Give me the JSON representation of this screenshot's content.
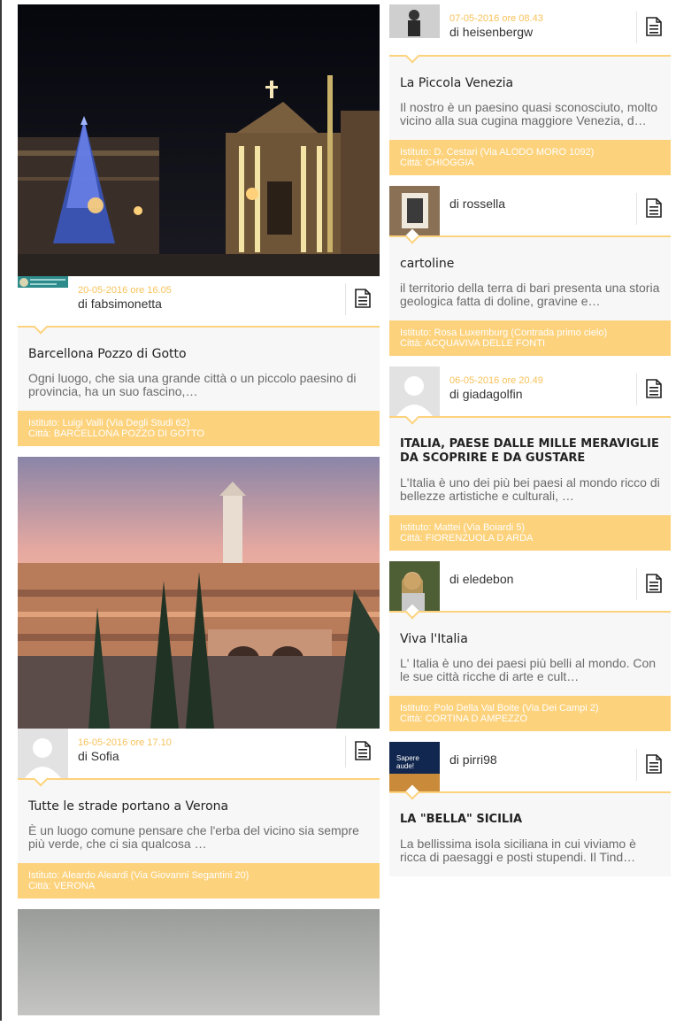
{
  "left": [
    {
      "date": "20-05-2016 ore 16.05",
      "author": "di fabsimonetta",
      "title": "Barcellona Pozzo di Gotto",
      "excerpt": "Ogni luogo, che sia una grande città o un piccolo paesino di provincia, ha un suo fascino,…",
      "istituto": "Istituto: Luigi Valli (Via Degli Studi 62)",
      "citta": "Città: BARCELLONA POZZO DI GOTTO"
    },
    {
      "date": "16-05-2016 ore 17.10",
      "author": "di Sofia",
      "title": "Tutte le strade portano a Verona",
      "excerpt": "È un luogo comune pensare che l'erba del vicino sia sempre più verde, che ci sia qualcosa …",
      "istituto": "Istituto: Aleardo Aleardi (Via Giovanni Segantini 20)",
      "citta": "Città: VERONA"
    }
  ],
  "right": [
    {
      "date": "07-05-2016 ore 08.43",
      "author": "di heisenbergw",
      "title": "La Piccola Venezia",
      "excerpt": "Il nostro è un paesino quasi sconosciuto, molto vicino alla sua cugina maggiore Venezia, d…",
      "istituto": "Istituto: D. Cestari (Via ALODO MORO 1092)",
      "citta": "Città: CHIOGGIA"
    },
    {
      "author": "di rossella",
      "title": "cartoline",
      "excerpt": "il territorio della terra di bari presenta una storia geologica fatta di doline, gravine e…",
      "istituto": "Istituto: Rosa Luxemburg (Contrada primo cielo)",
      "citta": "Città: ACQUAVIVA DELLE FONTI"
    },
    {
      "date": "06-05-2016 ore 20.49",
      "author": "di giadagolfin",
      "title": "ITALIA, PAESE DALLE MILLE MERAVIGLIE DA SCOPRIRE E DA GUSTARE",
      "excerpt": "L'Italia è uno dei più bei paesi al mondo ricco di bellezze artistiche e culturali, …",
      "istituto": "Istituto: Mattei (Via Boiardi 5)",
      "citta": "Città: FIORENZUOLA D ARDA"
    },
    {
      "author": "di eledebon",
      "title": "Viva l'Italia",
      "excerpt": "L' Italia è uno dei paesi più belli al mondo. Con le sue città ricche di arte e cult…",
      "istituto": "Istituto: Polo Della Val Boite (Via Dei Campi 2)",
      "citta": "Città: CORTINA D AMPEZZO"
    },
    {
      "author": "di pirri98",
      "avatar_text": "Sapere aude!",
      "title": "LA \"BELLA\" SICILIA",
      "excerpt": "La bellissima isola siciliana in cui viviamo è ricca di paesaggi e posti stupendi. Il Tind…"
    }
  ],
  "colors": {
    "accent": "#fdd27c",
    "date": "#f7c25a",
    "card_bg": "#f7f7f7"
  },
  "icons": {
    "doc": "document-icon",
    "avatar": "default-avatar-icon"
  }
}
